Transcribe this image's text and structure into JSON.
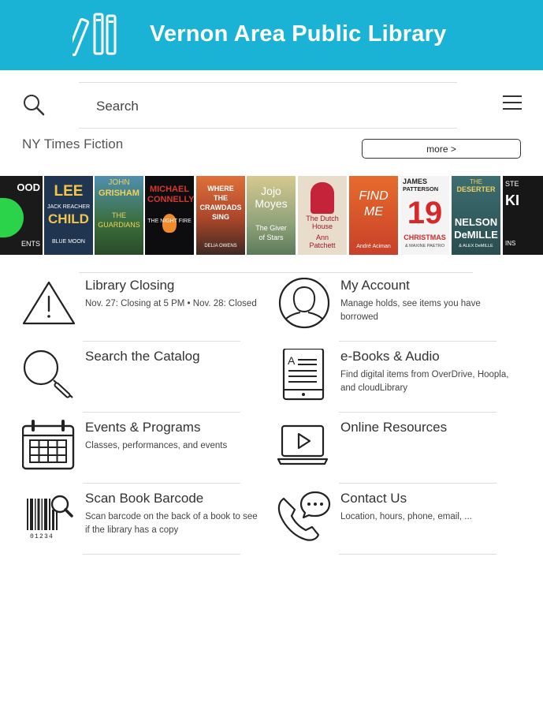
{
  "header": {
    "title": "Vernon Area Public Library"
  },
  "search": {
    "placeholder": "Search"
  },
  "featured": {
    "title": "NY Times Fiction",
    "more_label": "more >",
    "books": [
      {
        "title_lines": [
          "OOD",
          "",
          "ENTS"
        ]
      },
      {
        "title_lines": [
          "LEE",
          "JACK REACHER",
          "CHILD",
          "BLUE MOON"
        ]
      },
      {
        "title_lines": [
          "JOHN",
          "GRISHAM",
          "THE",
          "GUARDIANS"
        ]
      },
      {
        "title_lines": [
          "MICHAEL",
          "CONNELLY",
          "THE NIGHT FIRE"
        ]
      },
      {
        "title_lines": [
          "WHERE",
          "THE",
          "CRAWDADS",
          "SING",
          "DELIA OWENS"
        ]
      },
      {
        "title_lines": [
          "Jojo",
          "Moyes",
          "The Giver",
          "of Stars"
        ]
      },
      {
        "title_lines": [
          "The Dutch",
          "House",
          "Ann",
          "Patchett"
        ]
      },
      {
        "title_lines": [
          "FIND",
          "ME",
          "André Aciman"
        ]
      },
      {
        "title_lines": [
          "JAMES",
          "PATTERSON",
          "19",
          "CHRISTMAS",
          "& MAXINE PAETRO"
        ]
      },
      {
        "title_lines": [
          "THE",
          "DESERTER",
          "NELSON",
          "DeMILLE",
          "& ALEX DeMILLE"
        ]
      },
      {
        "title_lines": [
          "STE",
          "KI",
          "INS"
        ]
      }
    ]
  },
  "tiles": [
    {
      "title": "Library Closing",
      "desc": "Nov. 27: Closing at 5 PM • Nov. 28: Closed",
      "icon": "warning-icon"
    },
    {
      "title": "My Account",
      "desc": "Manage holds, see items you have borrowed",
      "icon": "user-icon"
    },
    {
      "title": "Search the Catalog",
      "desc": "",
      "icon": "magnifier-icon"
    },
    {
      "title": "e-Books & Audio",
      "desc": "Find digital items from OverDrive, Hoopla, and cloudLibrary",
      "icon": "ebook-icon"
    },
    {
      "title": "Events & Programs",
      "desc": "Classes, performances, and events",
      "icon": "calendar-icon"
    },
    {
      "title": "Online Resources",
      "desc": "",
      "icon": "laptop-play-icon"
    },
    {
      "title": "Scan Book Barcode",
      "desc": "Scan barcode on the back of a book to see if the library has a copy",
      "icon": "barcode-icon"
    },
    {
      "title": "Contact Us",
      "desc": "Location, hours, phone, email, ...",
      "icon": "phone-chat-icon"
    }
  ],
  "barcode_digits": "01234",
  "colors": {
    "header": "#1ab3d6"
  }
}
